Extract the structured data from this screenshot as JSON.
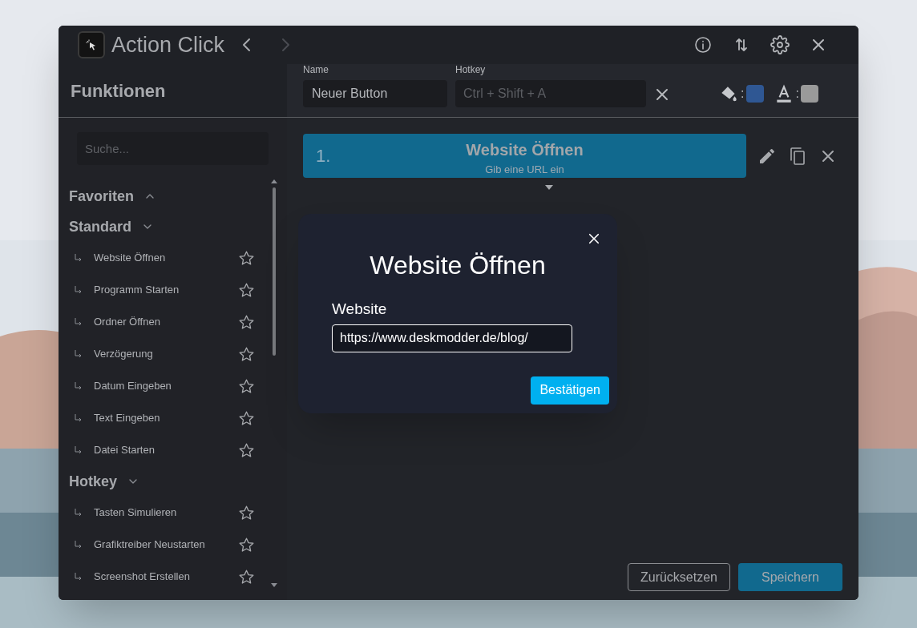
{
  "window": {
    "title": "Action Click",
    "back": {
      "disabled": false
    },
    "forward": {
      "disabled": true
    }
  },
  "sidebar": {
    "title": "Funktionen",
    "search": {
      "placeholder": "Suche..."
    },
    "groups": [
      {
        "label": "Favoriten",
        "expanded": false
      },
      {
        "label": "Standard",
        "expanded": true,
        "items": [
          {
            "label": "Website Öffnen",
            "favorite": false
          },
          {
            "label": "Programm Starten",
            "favorite": false
          },
          {
            "label": "Ordner Öffnen",
            "favorite": false
          },
          {
            "label": "Verzögerung",
            "favorite": false
          },
          {
            "label": "Datum Eingeben",
            "favorite": false
          },
          {
            "label": "Text Eingeben",
            "favorite": false
          },
          {
            "label": "Datei Starten",
            "favorite": false
          }
        ]
      },
      {
        "label": "Hotkey",
        "expanded": true,
        "items": [
          {
            "label": "Tasten Simulieren",
            "favorite": false
          },
          {
            "label": "Grafiktreiber Neustarten",
            "favorite": false
          },
          {
            "label": "Screenshot Erstellen",
            "favorite": false
          }
        ]
      }
    ]
  },
  "toolbar": {
    "name": {
      "label": "Name",
      "value": "Neuer Button"
    },
    "hotkey": {
      "label": "Hotkey",
      "placeholder": "Ctrl + Shift + A"
    },
    "separator_1": ":",
    "separator_2": ":",
    "swatches": [
      {
        "color": "#2f5793"
      },
      {
        "color": "#9a9a9a"
      }
    ]
  },
  "actions": [
    {
      "number": "1.",
      "title": "Website Öffnen",
      "subtitle": "Gib eine URL ein"
    }
  ],
  "dialog": {
    "title": "Website Öffnen",
    "field_label": "Website",
    "value": "https://www.deskmodder.de/blog/",
    "confirm": "Bestätigen"
  },
  "buttons": {
    "reset": "Zurücksetzen",
    "save": "Speichern"
  }
}
